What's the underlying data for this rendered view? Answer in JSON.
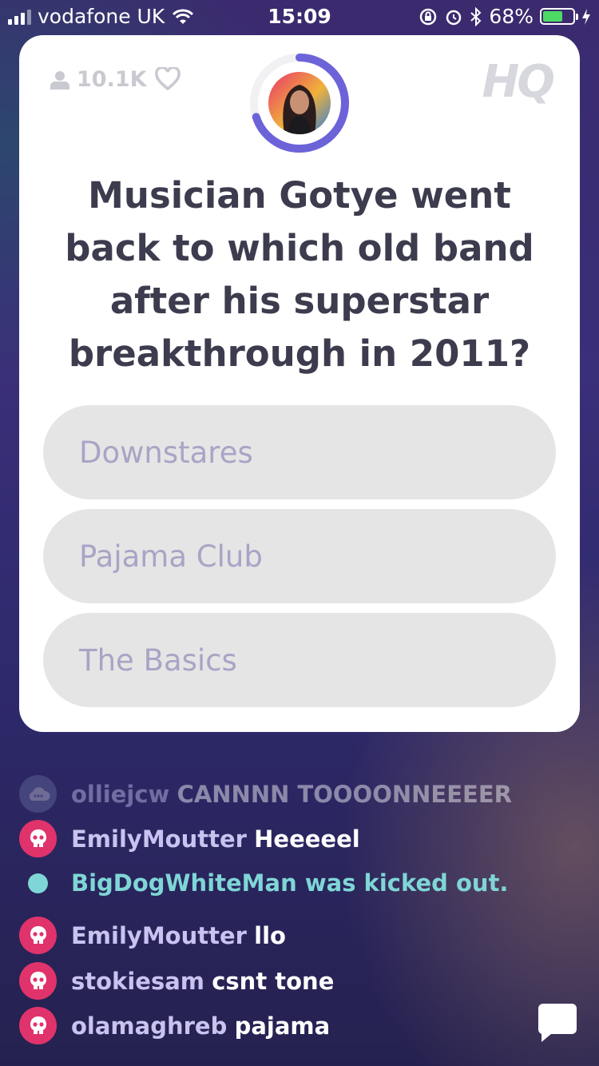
{
  "status_bar": {
    "carrier": "vodafone UK",
    "time": "15:09",
    "battery_percent": "68%",
    "battery_level": 0.68
  },
  "card": {
    "viewer_count": "10.1K",
    "logo": "HQ",
    "timer_progress": 0.7,
    "question": "Musician Gotye went back to which old band after his superstar breakthrough in 2011?",
    "answers": [
      "Downstares",
      "Pajama Club",
      "The Basics"
    ]
  },
  "chat": [
    {
      "user": "olliejcw",
      "message": "CANNNN TOOOONNEEEER"
    },
    {
      "user": "EmilyMoutter",
      "message": "Heeeeel"
    },
    {
      "system": "BigDogWhiteMan was kicked out."
    },
    {
      "user": "EmilyMoutter",
      "message": "llo"
    },
    {
      "user": "stokiesam",
      "message": "csnt tone"
    },
    {
      "user": "olamaghreb",
      "message": "pajama"
    }
  ],
  "colors": {
    "accent": "#6c63d9",
    "answer_bg": "#e5e5e5",
    "answer_text": "#a9a4c6",
    "question_text": "#3c3c4e",
    "chat_avatar": "#e0336b",
    "kicked_text": "#7fd6d6"
  },
  "icons": [
    "signal-icon",
    "wifi-icon",
    "rotation-lock-icon",
    "alarm-icon",
    "bluetooth-icon",
    "battery-icon",
    "charging-icon",
    "person-icon",
    "heart-icon",
    "skull-icon",
    "cloud-avatar-icon",
    "chat-bubble-icon"
  ]
}
